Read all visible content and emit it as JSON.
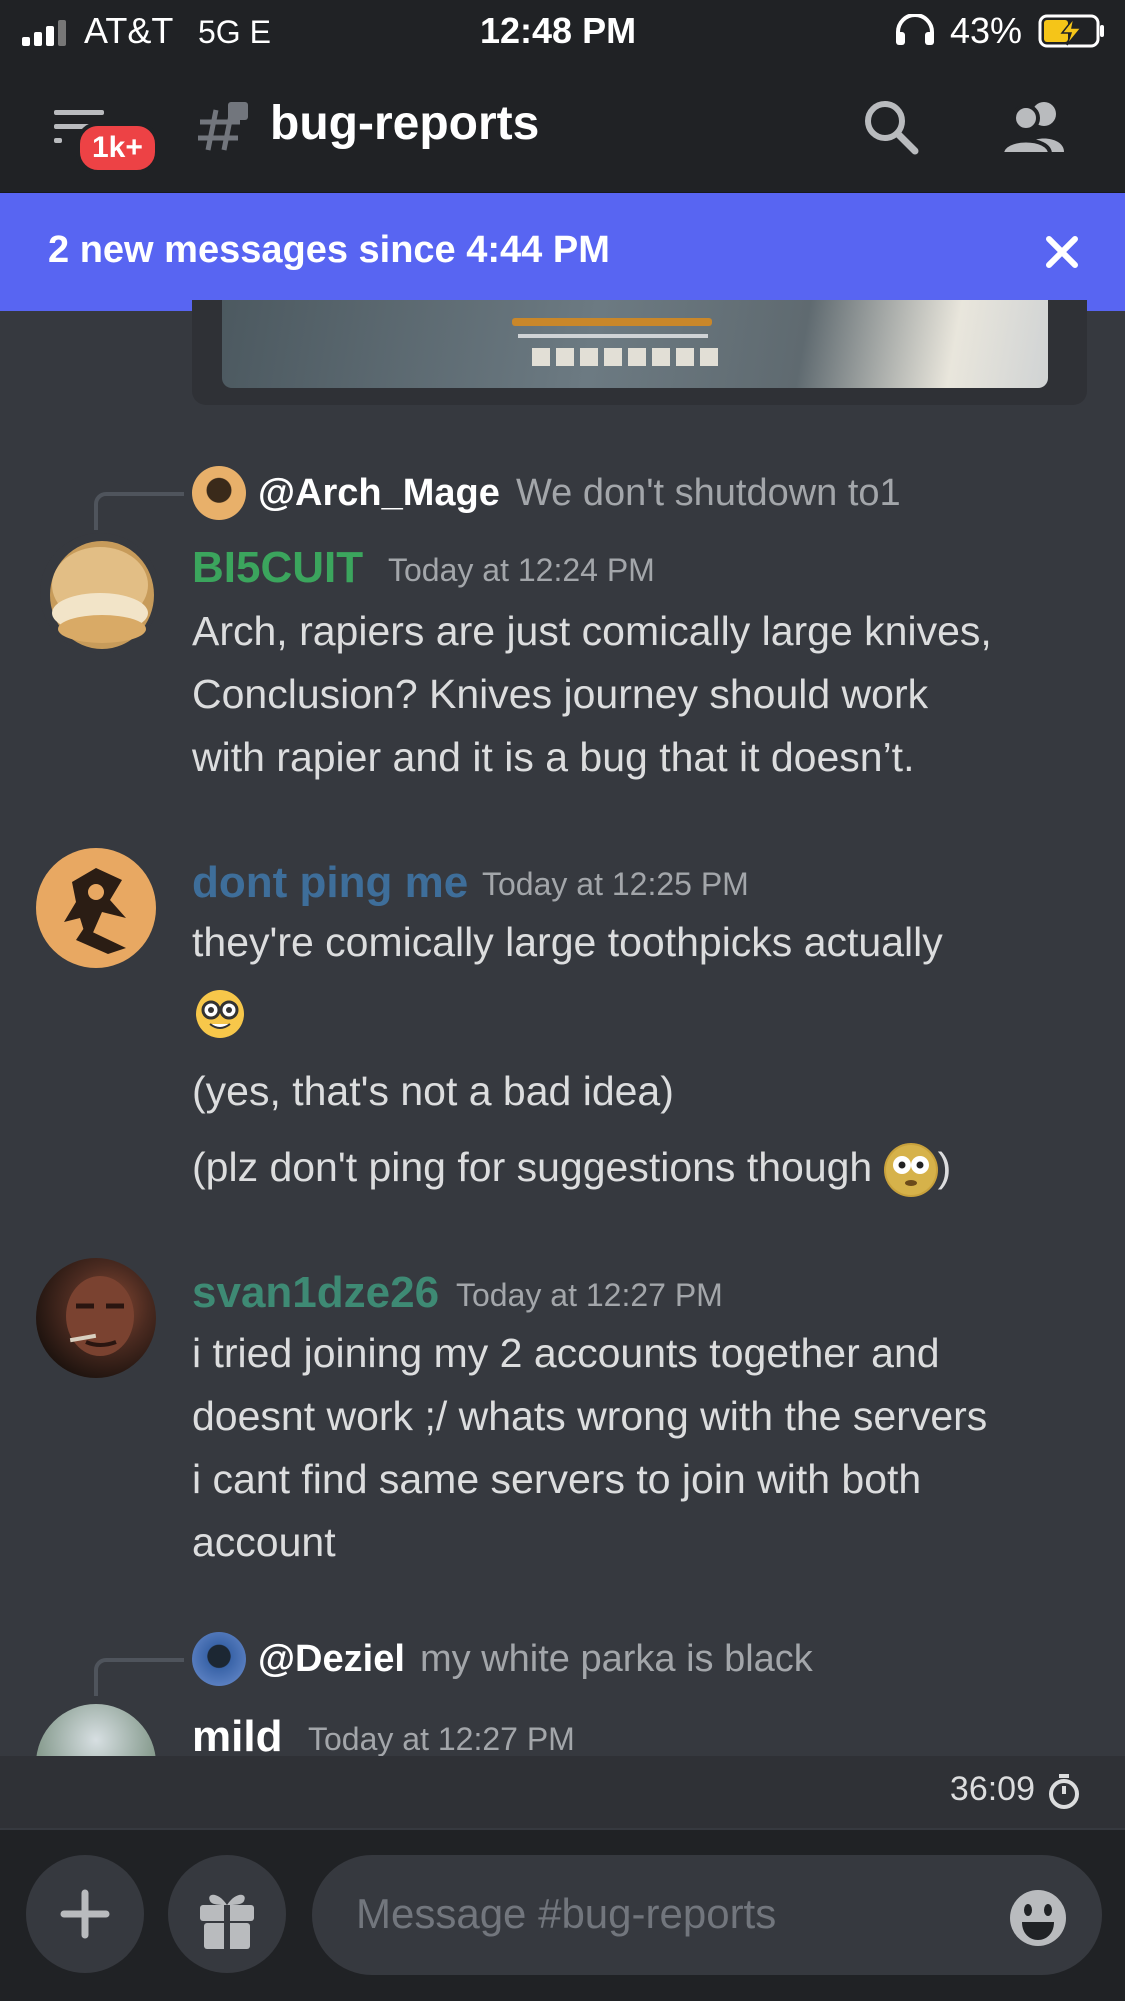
{
  "status_bar": {
    "carrier": "AT&T",
    "network": "5G E",
    "time": "12:48 PM",
    "battery": "43%"
  },
  "header": {
    "badge": "1k+",
    "channel_name": "bug-reports"
  },
  "new_messages_bar": {
    "text": "2 new messages since 4:44 PM"
  },
  "messages": [
    {
      "reply_to": {
        "name": "@Arch_Mage",
        "text": "We don't shutdown to1"
      },
      "author": "BI5CUIT",
      "author_color": "#3ba55d",
      "timestamp": "Today at 12:24 PM",
      "lines": [
        "Arch, rapiers are just comically large knives,",
        "Conclusion? Knives journey should work",
        "with rapier and it is a bug that it doesn’t."
      ]
    },
    {
      "author": "dont ping me",
      "author_color": "#3e6e9a",
      "timestamp": "Today at 12:25 PM",
      "lines": [
        "they're comically large toothpicks actually"
      ],
      "extra_lines": [
        "(yes, that's not a bad idea)",
        "(plz don't ping for suggestions though",
        ")"
      ]
    },
    {
      "author": "svan1dze26",
      "author_color": "#3e8a74",
      "timestamp": "Today at 12:27 PM",
      "lines": [
        "i tried joining my 2 accounts together and",
        "doesnt work ;/ whats wrong with the servers",
        "i cant find same servers to join with both",
        "account"
      ]
    },
    {
      "reply_to": {
        "name": "@Deziel",
        "text": "my white parka is black"
      },
      "author": "mild",
      "author_color": "#ffffff",
      "timestamp": "Today at 12:27 PM"
    }
  ],
  "timer": "36:09",
  "composer": {
    "placeholder": "Message #bug-reports"
  }
}
